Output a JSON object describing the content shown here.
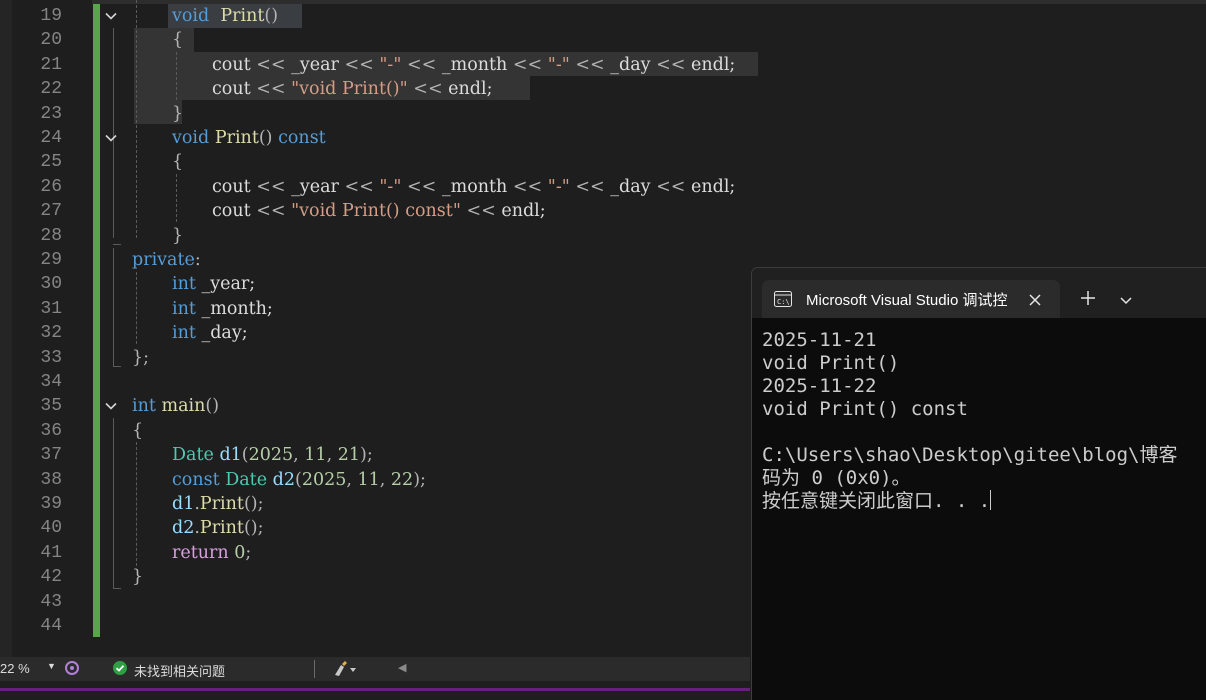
{
  "editor": {
    "lines": [
      {
        "n": "19",
        "indent": 2,
        "fold": true,
        "tokens": [
          [
            "kw",
            "void"
          ],
          [
            "",
            "  "
          ],
          [
            "fn",
            "Print"
          ],
          [
            "op",
            "()"
          ]
        ]
      },
      {
        "n": "20",
        "indent": 2,
        "tokens": [
          [
            "op",
            "{"
          ]
        ]
      },
      {
        "n": "21",
        "indent": 3,
        "tokens": [
          [
            "var",
            "cout "
          ],
          [
            "op",
            "<<"
          ],
          [
            "var",
            " _year "
          ],
          [
            "op",
            "<<"
          ],
          [
            "var",
            " "
          ],
          [
            "str",
            "\"-\""
          ],
          [
            "var",
            " "
          ],
          [
            "op",
            "<<"
          ],
          [
            "var",
            " _month "
          ],
          [
            "op",
            "<<"
          ],
          [
            "var",
            " "
          ],
          [
            "str",
            "\"-\""
          ],
          [
            "var",
            " "
          ],
          [
            "op",
            "<<"
          ],
          [
            "var",
            " _day "
          ],
          [
            "op",
            "<<"
          ],
          [
            "var",
            " endl;"
          ]
        ]
      },
      {
        "n": "22",
        "indent": 3,
        "tokens": [
          [
            "var",
            "cout "
          ],
          [
            "op",
            "<<"
          ],
          [
            "var",
            " "
          ],
          [
            "str",
            "\"void Print()\""
          ],
          [
            "var",
            " "
          ],
          [
            "op",
            "<<"
          ],
          [
            "var",
            " endl;"
          ]
        ]
      },
      {
        "n": "23",
        "indent": 2,
        "tokens": [
          [
            "op",
            "}"
          ]
        ]
      },
      {
        "n": "24",
        "indent": 2,
        "fold": true,
        "tokens": [
          [
            "kw",
            "void"
          ],
          [
            "var",
            " "
          ],
          [
            "fn",
            "Print"
          ],
          [
            "op",
            "()"
          ],
          [
            "var",
            " "
          ],
          [
            "kw",
            "const"
          ]
        ]
      },
      {
        "n": "25",
        "indent": 2,
        "tokens": [
          [
            "op",
            "{"
          ]
        ]
      },
      {
        "n": "26",
        "indent": 3,
        "tokens": [
          [
            "var",
            "cout "
          ],
          [
            "op",
            "<<"
          ],
          [
            "var",
            " _year "
          ],
          [
            "op",
            "<<"
          ],
          [
            "var",
            " "
          ],
          [
            "str",
            "\"-\""
          ],
          [
            "var",
            " "
          ],
          [
            "op",
            "<<"
          ],
          [
            "var",
            " _month "
          ],
          [
            "op",
            "<<"
          ],
          [
            "var",
            " "
          ],
          [
            "str",
            "\"-\""
          ],
          [
            "var",
            " "
          ],
          [
            "op",
            "<<"
          ],
          [
            "var",
            " _day "
          ],
          [
            "op",
            "<<"
          ],
          [
            "var",
            " endl;"
          ]
        ]
      },
      {
        "n": "27",
        "indent": 3,
        "tokens": [
          [
            "var",
            "cout "
          ],
          [
            "op",
            "<<"
          ],
          [
            "var",
            " "
          ],
          [
            "str",
            "\"void Print() const\""
          ],
          [
            "var",
            " "
          ],
          [
            "op",
            "<<"
          ],
          [
            "var",
            " endl;"
          ]
        ]
      },
      {
        "n": "28",
        "indent": 2,
        "tokens": [
          [
            "op",
            "}"
          ]
        ]
      },
      {
        "n": "29",
        "indent": 1,
        "tokens": [
          [
            "kw",
            "private"
          ],
          [
            "op",
            ":"
          ]
        ]
      },
      {
        "n": "30",
        "indent": 2,
        "tokens": [
          [
            "kw",
            "int"
          ],
          [
            "var",
            " _year;"
          ]
        ]
      },
      {
        "n": "31",
        "indent": 2,
        "tokens": [
          [
            "kw",
            "int"
          ],
          [
            "var",
            " _month;"
          ]
        ]
      },
      {
        "n": "32",
        "indent": 2,
        "tokens": [
          [
            "kw",
            "int"
          ],
          [
            "var",
            " _day;"
          ]
        ]
      },
      {
        "n": "33",
        "indent": 1,
        "tokens": [
          [
            "op",
            "};"
          ]
        ]
      },
      {
        "n": "34",
        "indent": 0,
        "tokens": []
      },
      {
        "n": "35",
        "indent": 1,
        "fold": true,
        "tokens": [
          [
            "kw",
            "int"
          ],
          [
            "var",
            " "
          ],
          [
            "fn",
            "main"
          ],
          [
            "op",
            "()"
          ]
        ]
      },
      {
        "n": "36",
        "indent": 1,
        "tokens": [
          [
            "op",
            "{"
          ]
        ]
      },
      {
        "n": "37",
        "indent": 2,
        "tokens": [
          [
            "typ",
            "Date"
          ],
          [
            "var",
            " "
          ],
          [
            "lv",
            "d1"
          ],
          [
            "op",
            "("
          ],
          [
            "num",
            "2025"
          ],
          [
            "op",
            ", "
          ],
          [
            "num",
            "11"
          ],
          [
            "op",
            ", "
          ],
          [
            "num",
            "21"
          ],
          [
            "op",
            ");"
          ]
        ]
      },
      {
        "n": "38",
        "indent": 2,
        "tokens": [
          [
            "kw",
            "const"
          ],
          [
            "var",
            " "
          ],
          [
            "typ",
            "Date"
          ],
          [
            "var",
            " "
          ],
          [
            "lv",
            "d2"
          ],
          [
            "op",
            "("
          ],
          [
            "num",
            "2025"
          ],
          [
            "op",
            ", "
          ],
          [
            "num",
            "11"
          ],
          [
            "op",
            ", "
          ],
          [
            "num",
            "22"
          ],
          [
            "op",
            ");"
          ]
        ]
      },
      {
        "n": "39",
        "indent": 2,
        "tokens": [
          [
            "lv",
            "d1"
          ],
          [
            "op",
            "."
          ],
          [
            "fn",
            "Print"
          ],
          [
            "op",
            "();"
          ]
        ]
      },
      {
        "n": "40",
        "indent": 2,
        "tokens": [
          [
            "lv",
            "d2"
          ],
          [
            "op",
            "."
          ],
          [
            "fn",
            "Print"
          ],
          [
            "op",
            "();"
          ]
        ]
      },
      {
        "n": "41",
        "indent": 2,
        "tokens": [
          [
            "ctl",
            "return"
          ],
          [
            "var",
            " "
          ],
          [
            "num",
            "0"
          ],
          [
            "op",
            ";"
          ]
        ]
      },
      {
        "n": "42",
        "indent": 1,
        "tokens": [
          [
            "op",
            "}"
          ]
        ]
      },
      {
        "n": "43",
        "indent": 0,
        "tokens": []
      },
      {
        "n": "44",
        "indent": 0,
        "tokens": []
      }
    ]
  },
  "statusbar": {
    "zoom": "22 %",
    "issues_text": "未找到相关问题"
  },
  "terminal": {
    "tab_title": "Microsoft Visual Studio 调试控",
    "output_lines": [
      "2025-11-21",
      "void Print()",
      "2025-11-22",
      "void Print() const",
      "",
      "C:\\Users\\shao\\Desktop\\gitee\\blog\\博客",
      "码为 0 (0x0)。",
      "按任意键关闭此窗口. . ."
    ]
  },
  "colors": {
    "editor_bg": "#1e1e1e",
    "keyword": "#569cd6",
    "function": "#dcdcaa",
    "string": "#d69d85",
    "number": "#b5cea8",
    "type": "#4ec9b0",
    "control": "#d8a0df",
    "change_bar": "#57a64a",
    "terminal_bg": "#0c0c0c",
    "status_accent": "#68217a"
  }
}
